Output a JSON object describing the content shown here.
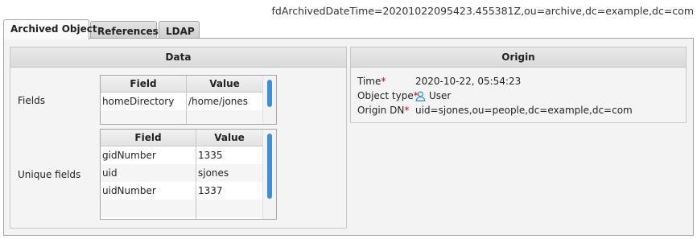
{
  "header": {
    "dn": "fdArchivedDateTime=20201022095423.455381Z,ou=archive,dc=example,dc=com"
  },
  "tabs": [
    {
      "label": "Archived Object",
      "active": true
    },
    {
      "label": "References",
      "active": false
    },
    {
      "label": "LDAP",
      "active": false
    }
  ],
  "data_section": {
    "title": "Data",
    "fields_label": "Fields",
    "unique_fields_label": "Unique fields",
    "fields_table": {
      "columns": [
        "Field",
        "Value"
      ],
      "rows": [
        {
          "field": "homeDirectory",
          "value": "/home/jones"
        }
      ]
    },
    "unique_table": {
      "columns": [
        "Field",
        "Value"
      ],
      "rows": [
        {
          "field": "gidNumber",
          "value": "1335"
        },
        {
          "field": "uid",
          "value": "sjones"
        },
        {
          "field": "uidNumber",
          "value": "1337"
        }
      ]
    }
  },
  "origin_section": {
    "title": "Origin",
    "time_label": "Time",
    "time_value": "2020-10-22, 05:54:23",
    "object_type_label": "Object type",
    "object_type_icon": "user-icon",
    "object_type_value": "User",
    "origin_dn_label": "Origin DN",
    "origin_dn_value": "uid=sjones,ou=people,dc=example,dc=com",
    "required_marker": "*"
  },
  "colors": {
    "accent": "#3d8fd8",
    "required": "#cc0000"
  }
}
